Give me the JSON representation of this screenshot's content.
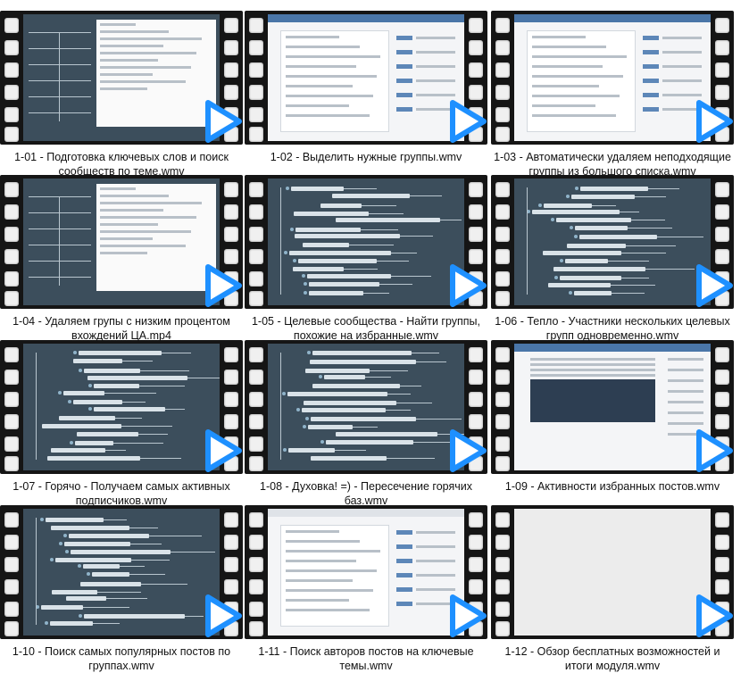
{
  "videos": [
    {
      "title": "1-01 - Подготовка ключевых слов и поиск сообществ по теме.wmv"
    },
    {
      "title": "1-02 - Выделить нужные группы.wmv"
    },
    {
      "title": "1-03 - Автоматически удаляем неподходящие группы из большого списка.wmv"
    },
    {
      "title": "1-04 - Удаляем групы с низким процентом вхождений ЦА.mp4"
    },
    {
      "title": "1-05 - Целевые сообщества - Найти группы, похожие на избранные.wmv"
    },
    {
      "title": "1-06 - Тепло - Участники нескольких целевых групп одновременно.wmv"
    },
    {
      "title": "1-07 - Горячо - Получаем самых активных подписчиков.wmv"
    },
    {
      "title": "1-08 - Духовка! =) - Пересечение горячих баз.wmv"
    },
    {
      "title": "1-09 - Активности избранных постов.wmv"
    },
    {
      "title": "1-10 - Поиск самых популярных постов по группах.wmv"
    },
    {
      "title": "1-11 - Поиск авторов постов на ключевые темы.wmv"
    },
    {
      "title": "1-12 - Обзор бесплатных возможностей и итоги модуля.wmv"
    }
  ],
  "colors": {
    "play_icon": "#1e90ff",
    "film_frame": "#151515",
    "mindmap_bg": "#3c4e5c"
  },
  "icons": {
    "play": "play-icon",
    "film": "film-strip-icon"
  }
}
